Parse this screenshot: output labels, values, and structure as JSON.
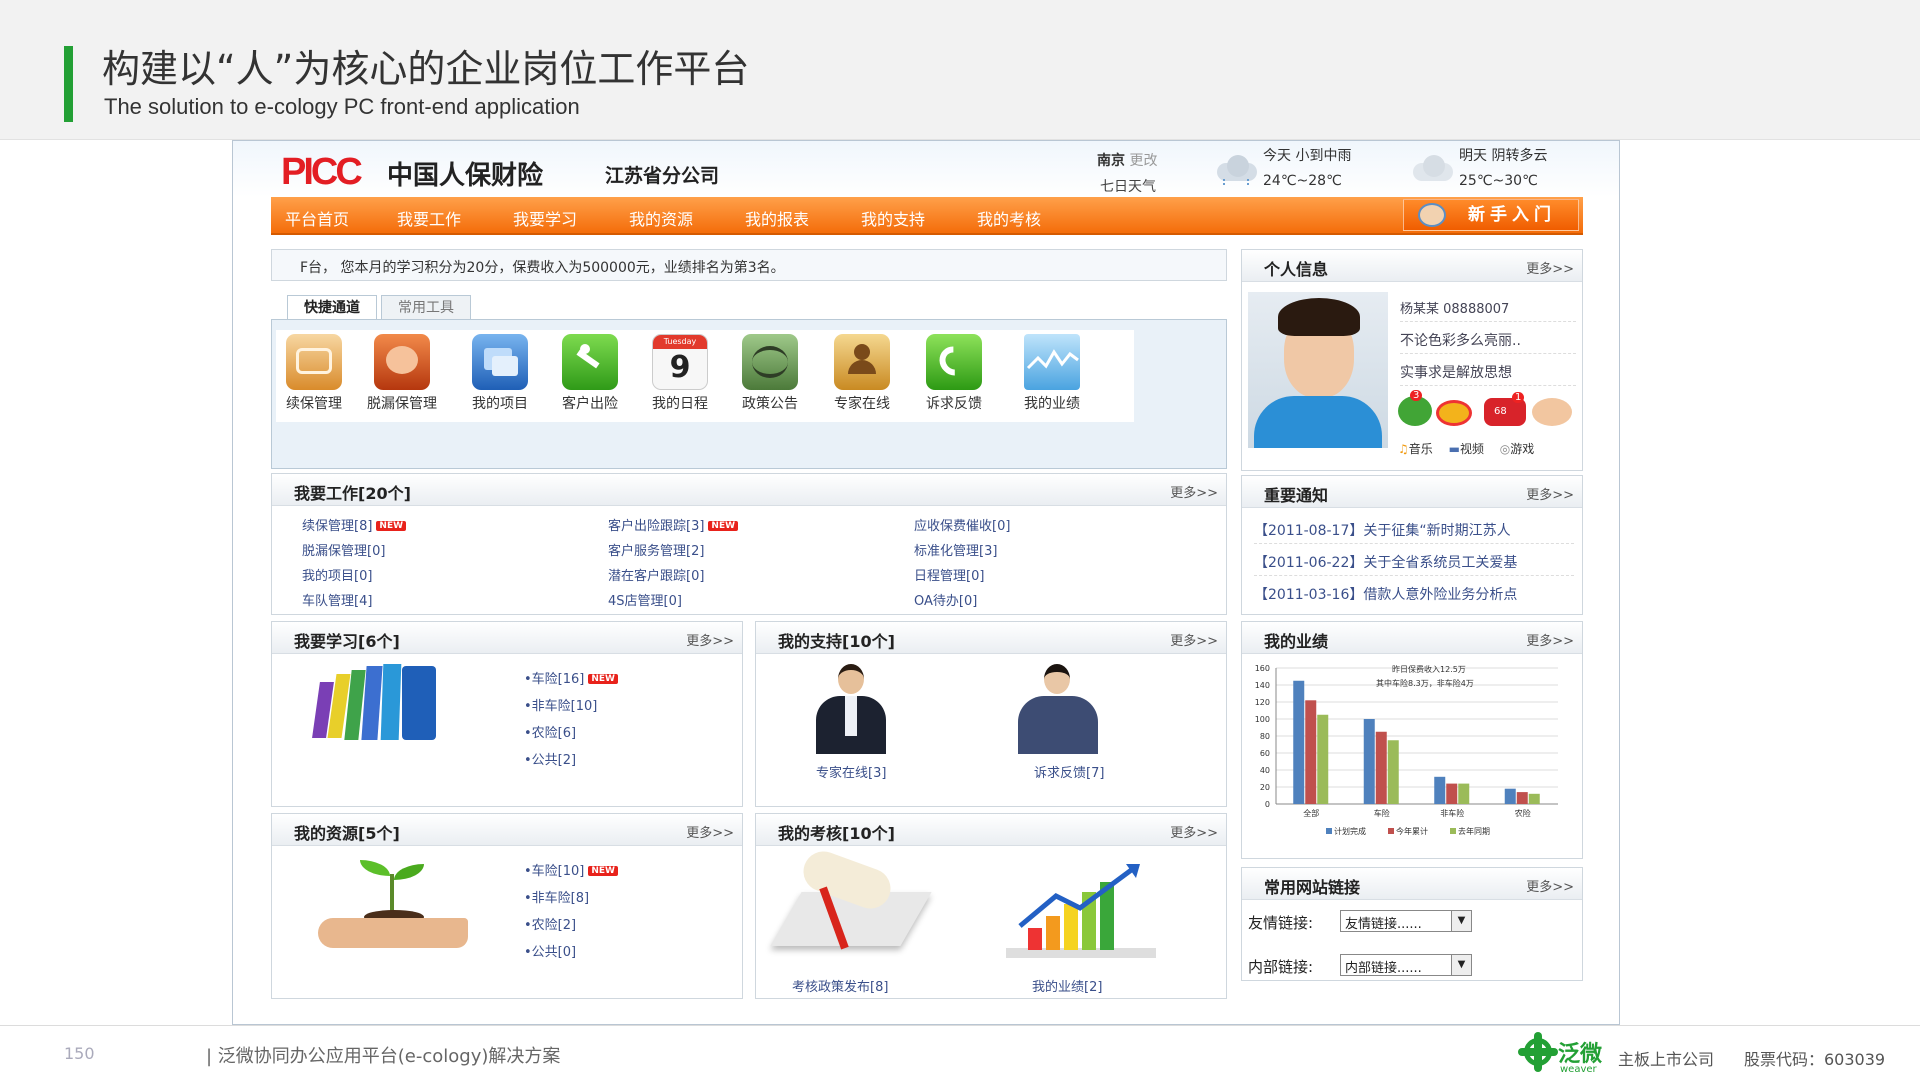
{
  "slide": {
    "title": "构建以“人”为核心的企业岗位工作平台",
    "subtitle": "The solution to e-cology PC front-end application",
    "page": "150",
    "footer": "| 泛微协同办公应用平台(e-cology)解决方案",
    "brand": "泛微",
    "brand_sub": "weaver",
    "listing": "主板上市公司",
    "stock": "股票代码：603039",
    "accent": "#23a035"
  },
  "portal": {
    "logo": "PICC",
    "company": "中国人保财险",
    "branch": "江苏省分公司",
    "weather": {
      "city": "南京",
      "change": "更改",
      "seven": "七日天气",
      "today_label": "今天 小到中雨",
      "today_temp": "24℃~28℃",
      "tomorrow_label": "明天 阴转多云",
      "tomorrow_temp": "25℃~30℃"
    },
    "nav": [
      "平台首页",
      "我要工作",
      "我要学习",
      "我的资源",
      "我的报表",
      "我的支持",
      "我的考核"
    ],
    "newbie": "新手入门",
    "notice": "F台， 您本月的学习积分为20分，保费收入为500000元，业绩排名为第3名。",
    "tabs": [
      "快捷通道",
      "常用工具"
    ],
    "quick": [
      "续保管理",
      "脱漏保管理",
      "我的项目",
      "客户出险",
      "我的日程",
      "政策公告",
      "专家在线",
      "诉求反馈",
      "我的业绩"
    ],
    "calendar": {
      "day": "Tuesday",
      "num": "9"
    },
    "work": {
      "title": "我要工作[20个]",
      "more": "更多>>",
      "col1": [
        "续保管理[8]",
        "脱漏保管理[0]",
        "我的项目[0]",
        "车队管理[4]"
      ],
      "col2": [
        "客户出险跟踪[3]",
        "客户服务管理[2]",
        "潜在客户跟踪[0]",
        "4S店管理[0]"
      ],
      "col3": [
        "应收保费催收[0]",
        "标准化管理[3]",
        "日程管理[0]",
        "OA待办[0]"
      ]
    },
    "learn": {
      "title": "我要学习[6个]",
      "more": "更多>>",
      "items": [
        "•车险[16]",
        "•非车险[10]",
        "•农险[6]",
        "•公共[2]"
      ]
    },
    "support": {
      "title": "我的支持[10个]",
      "more": "更多>>",
      "expert": "专家在线[3]",
      "appeal": "诉求反馈[7]"
    },
    "resource": {
      "title": "我的资源[5个]",
      "more": "更多>>",
      "items": [
        "•车险[10]",
        "•非车险[8]",
        "•农险[2]",
        "•公共[0]"
      ]
    },
    "exam": {
      "title": "我的考核[10个]",
      "more": "更多>>",
      "policy": "考核政策发布[8]",
      "perf": "我的业绩[2]"
    },
    "profile": {
      "title": "个人信息",
      "more": "更多>>",
      "name": "杨某某 08888007",
      "motto1": "不论色彩多么亮丽..",
      "motto2": "实事求是解放思想",
      "badges": [
        "3",
        "",
        "68",
        "1"
      ],
      "music": "音乐",
      "video": "视频",
      "game": "游戏"
    },
    "news": {
      "title": "重要通知",
      "more": "更多>>",
      "items": [
        "【2011-08-17】关于征集“新时期江苏人",
        "【2011-06-22】关于全省系统员工关爱基",
        "【2011-03-16】借款人意外险业务分析点"
      ]
    },
    "perf": {
      "title": "我的业绩",
      "more": "更多>>"
    },
    "links": {
      "title": "常用网站链接",
      "more": "更多>>",
      "friend_label": "友情链接:",
      "friend_value": "友情链接......",
      "inner_label": "内部链接:",
      "inner_value": "内部链接......"
    }
  },
  "chart_data": {
    "type": "bar",
    "categories": [
      "全部",
      "车险",
      "非车险",
      "农险"
    ],
    "series": [
      {
        "name": "计划完成",
        "values": [
          145,
          100,
          32,
          18
        ]
      },
      {
        "name": "今年累计",
        "values": [
          122,
          85,
          24,
          14
        ]
      },
      {
        "name": "去年同期",
        "values": [
          105,
          75,
          24,
          12
        ]
      }
    ],
    "ylim": [
      0,
      160
    ],
    "yticks": [
      0,
      20,
      40,
      60,
      80,
      100,
      120,
      140,
      160
    ],
    "annotation1": "昨日保费收入12.5万",
    "annotation2": "其中车险8.3万，非车险4万",
    "colors": [
      "#4f81bd",
      "#c0504d",
      "#9bbb59"
    ]
  }
}
